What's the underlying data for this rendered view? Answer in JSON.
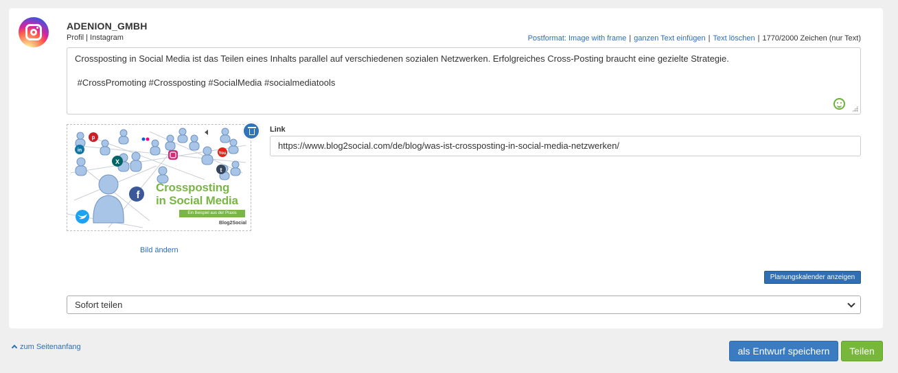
{
  "account": {
    "name": "ADENION_GMBH",
    "profile_type": "Profil",
    "network": "Instagram",
    "separator": "|"
  },
  "toolbar": {
    "postformat": "Postformat: Image with frame",
    "insert_text": "ganzen Text einfügen",
    "delete_text": "Text löschen",
    "char_count": "1770/2000 Zeichen (nur Text)"
  },
  "post": {
    "text": "Crossposting in Social Media ist das Teilen eines Inhalts parallel auf verschiedenen sozialen Netzwerken. Erfolgreiches Cross-Posting braucht eine gezielte Strategie.",
    "hashtags": " #CrossPromoting #Crossposting #SocialMedia #socialmediatools"
  },
  "image": {
    "title_line1": "Crossposting",
    "title_line2": "in Social Media",
    "subtitle": "Ein Beispiel aus der Praxis",
    "brand": "Blog2Social",
    "change_label": "Bild ändern"
  },
  "link": {
    "label": "Link",
    "value": "https://www.blog2social.com/de/blog/was-ist-crossposting-in-social-media-netzwerken/"
  },
  "schedule": {
    "calendar_button": "Planungskalender anzeigen",
    "selected": "Sofort teilen"
  },
  "footer": {
    "back_to_top": "zum Seitenanfang",
    "save_draft": "als Entwurf speichern",
    "share": "Teilen"
  },
  "colors": {
    "primary": "#3a7bc1",
    "success": "#77b83b",
    "link": "#2a6ebb",
    "image_green": "#7ab547"
  }
}
